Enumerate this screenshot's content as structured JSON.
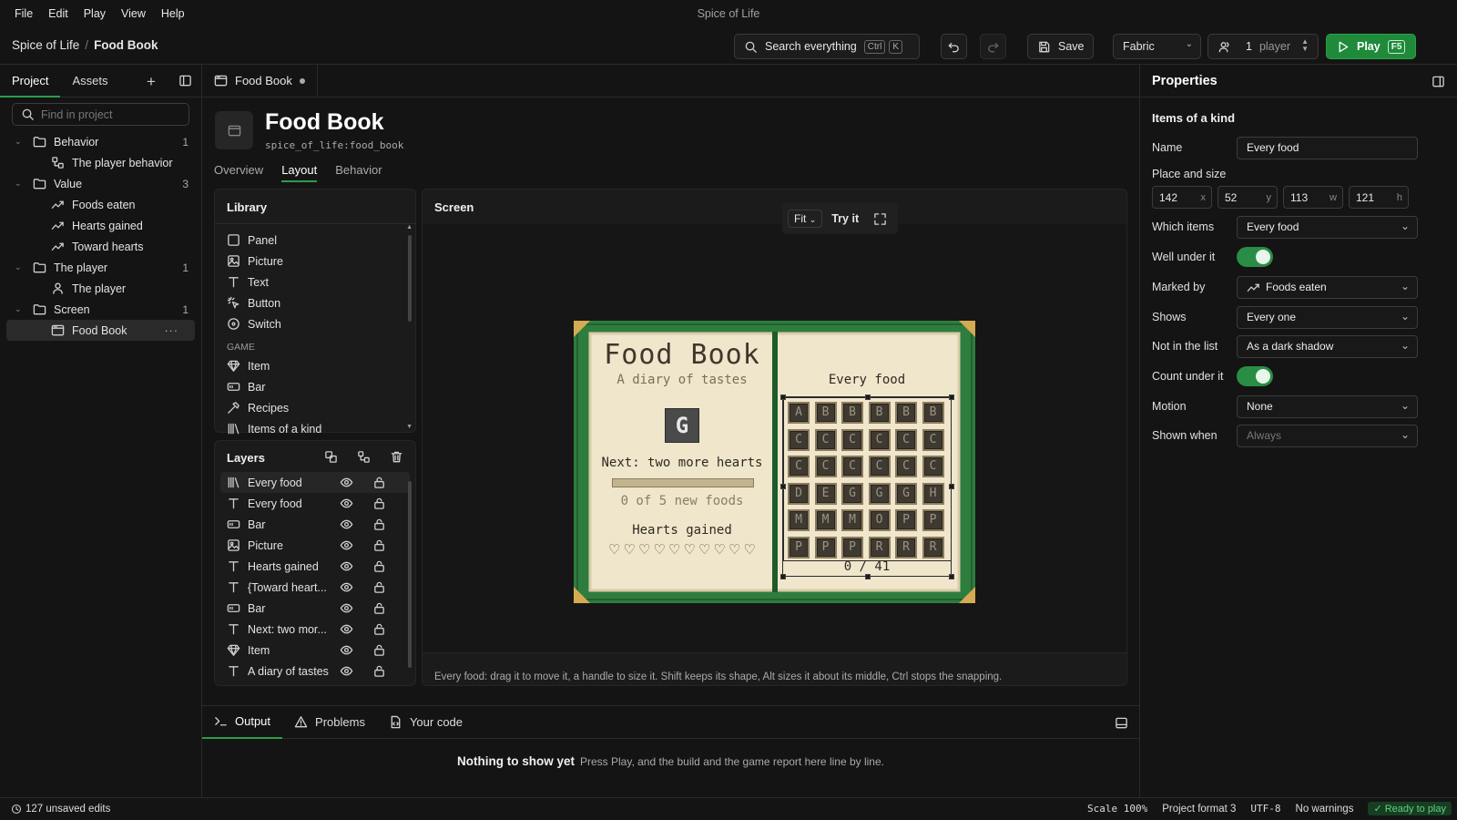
{
  "menu": [
    "File",
    "Edit",
    "Play",
    "View",
    "Help"
  ],
  "app_title": "Spice of Life",
  "breadcrumb": {
    "project": "Spice of Life",
    "sep": "/",
    "current": "Food Book"
  },
  "toolbar": {
    "search_label": "Search everything",
    "search_kbd1": "Ctrl",
    "search_kbd2": "K",
    "save_label": "Save",
    "loader": "Fabric",
    "players_count": "1",
    "players_label": "player",
    "play_label": "Play",
    "play_kbd": "F5"
  },
  "left": {
    "tabs": [
      "Project",
      "Assets"
    ],
    "search_placeholder": "Find in project",
    "tree": {
      "behavior": {
        "label": "Behavior",
        "count": "1",
        "children": [
          "The player behavior"
        ]
      },
      "value": {
        "label": "Value",
        "count": "3",
        "children": [
          "Foods eaten",
          "Hearts gained",
          "Toward hearts"
        ]
      },
      "player": {
        "label": "The player",
        "count": "1",
        "children": [
          "The player"
        ]
      },
      "screen": {
        "label": "Screen",
        "count": "1",
        "children": [
          "Food Book"
        ]
      }
    }
  },
  "doc_tab": "Food Book",
  "header": {
    "title": "Food Book",
    "id": "spice_of_life:food_book",
    "tabs": [
      "Overview",
      "Layout",
      "Behavior"
    ]
  },
  "library": {
    "title": "Library",
    "items": [
      "Panel",
      "Picture",
      "Text",
      "Button",
      "Switch"
    ],
    "section": "GAME",
    "game_items": [
      "Item",
      "Bar",
      "Recipes",
      "Items of a kind"
    ]
  },
  "layers": {
    "title": "Layers",
    "items": [
      "Every food",
      "Every food",
      "Bar",
      "Picture",
      "Hearts gained",
      "{Toward heart...",
      "Bar",
      "Next: two mor...",
      "Item",
      "A diary of tastes"
    ]
  },
  "screen": {
    "title": "Screen",
    "fit": "Fit",
    "try_label": "Try it",
    "hint": "Every food: drag it to move it, a handle to size it. Shift keeps its shape, Alt sizes it about its middle, Ctrl stops the snapping."
  },
  "book": {
    "title": "Food Book",
    "subtitle": "A diary of tastes",
    "item_glyph": "G",
    "next_text": "Next: two more hearts",
    "progress": 0,
    "progress_text": "0 of 5 new foods",
    "hearts_label": "Hearts gained",
    "hearts_count": 10,
    "right_title": "Every food",
    "grid": [
      [
        "A",
        "B",
        "B",
        "B",
        "B",
        "B"
      ],
      [
        "C",
        "C",
        "C",
        "C",
        "C",
        "C"
      ],
      [
        "C",
        "C",
        "C",
        "C",
        "C",
        "C"
      ],
      [
        "D",
        "E",
        "G",
        "G",
        "G",
        "H"
      ],
      [
        "M",
        "M",
        "M",
        "O",
        "P",
        "P"
      ],
      [
        "P",
        "P",
        "P",
        "R",
        "R",
        "R"
      ]
    ],
    "count_text": "0 / 41"
  },
  "output": {
    "tabs": [
      "Output",
      "Problems",
      "Your code"
    ],
    "empty_title": "Nothing to show yet",
    "empty_text": "Press Play, and the build and the game report here line by line."
  },
  "properties": {
    "title": "Properties",
    "subtitle": "Items of a kind",
    "name_label": "Name",
    "name_value": "Every food",
    "place_label": "Place and size",
    "x": "142",
    "y": "52",
    "w": "113",
    "h": "121",
    "x_unit": "x",
    "y_unit": "y",
    "w_unit": "w",
    "h_unit": "h",
    "which_label": "Which items",
    "which_value": "Every food",
    "well_label": "Well under it",
    "marked_label": "Marked by",
    "marked_value": "Foods eaten",
    "shows_label": "Shows",
    "shows_value": "Every one",
    "notinlist_label": "Not in the list",
    "notinlist_value": "As a dark shadow",
    "count_label": "Count under it",
    "motion_label": "Motion",
    "motion_value": "None",
    "shown_label": "Shown when",
    "shown_value": "Always"
  },
  "status": {
    "unsaved": "127 unsaved edits",
    "scale": "Scale 100%",
    "format": "Project format 3",
    "encoding": "UTF-8",
    "warnings": "No warnings",
    "ready": "Ready to play"
  },
  "colors": {
    "accent": "#2a9d4a",
    "book_green": "#2e7d3e",
    "page": "#efe6cc",
    "frame_gold": "#c9a04a"
  }
}
